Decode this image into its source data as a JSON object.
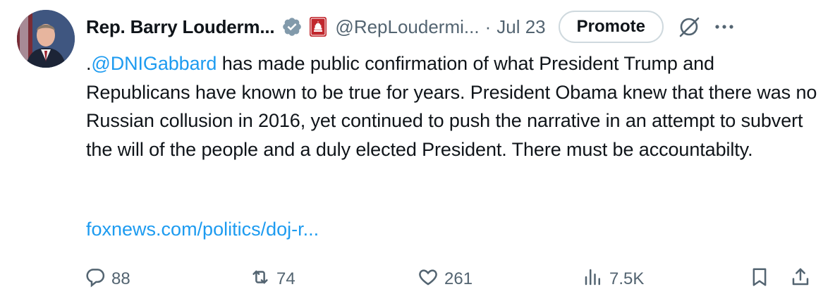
{
  "tweet": {
    "author_name": "Rep. Barry Louderm...",
    "handle": "@RepLoudermi...",
    "separator": "·",
    "date": "Jul 23",
    "promote_label": "Promote",
    "text_prefix": ".",
    "mention": "@DNIGabbard",
    "text_body": " has made public confirmation of what President Trump and Republicans have known to be true for years. President Obama knew that there was no Russian collusion in 2016, yet continued to push the narrative in an attempt to subvert the will of the people and a duly elected President. There must be accountabilty.",
    "link": "foxnews.com/politics/doj-r..."
  },
  "actions": {
    "replies": "88",
    "reposts": "74",
    "likes": "261",
    "views": "7.5K"
  },
  "icons": {
    "verified": "verified-badge-icon",
    "gov": "government-badge-icon",
    "grok": "grok-icon",
    "more": "more-icon",
    "reply": "reply-icon",
    "repost": "repost-icon",
    "like": "like-icon",
    "views": "views-icon",
    "bookmark": "bookmark-icon",
    "share": "share-icon"
  },
  "colors": {
    "link": "#1d9bf0",
    "secondary_text": "#536471",
    "verified": "#829aab",
    "gov_badge": "#c1272d"
  }
}
